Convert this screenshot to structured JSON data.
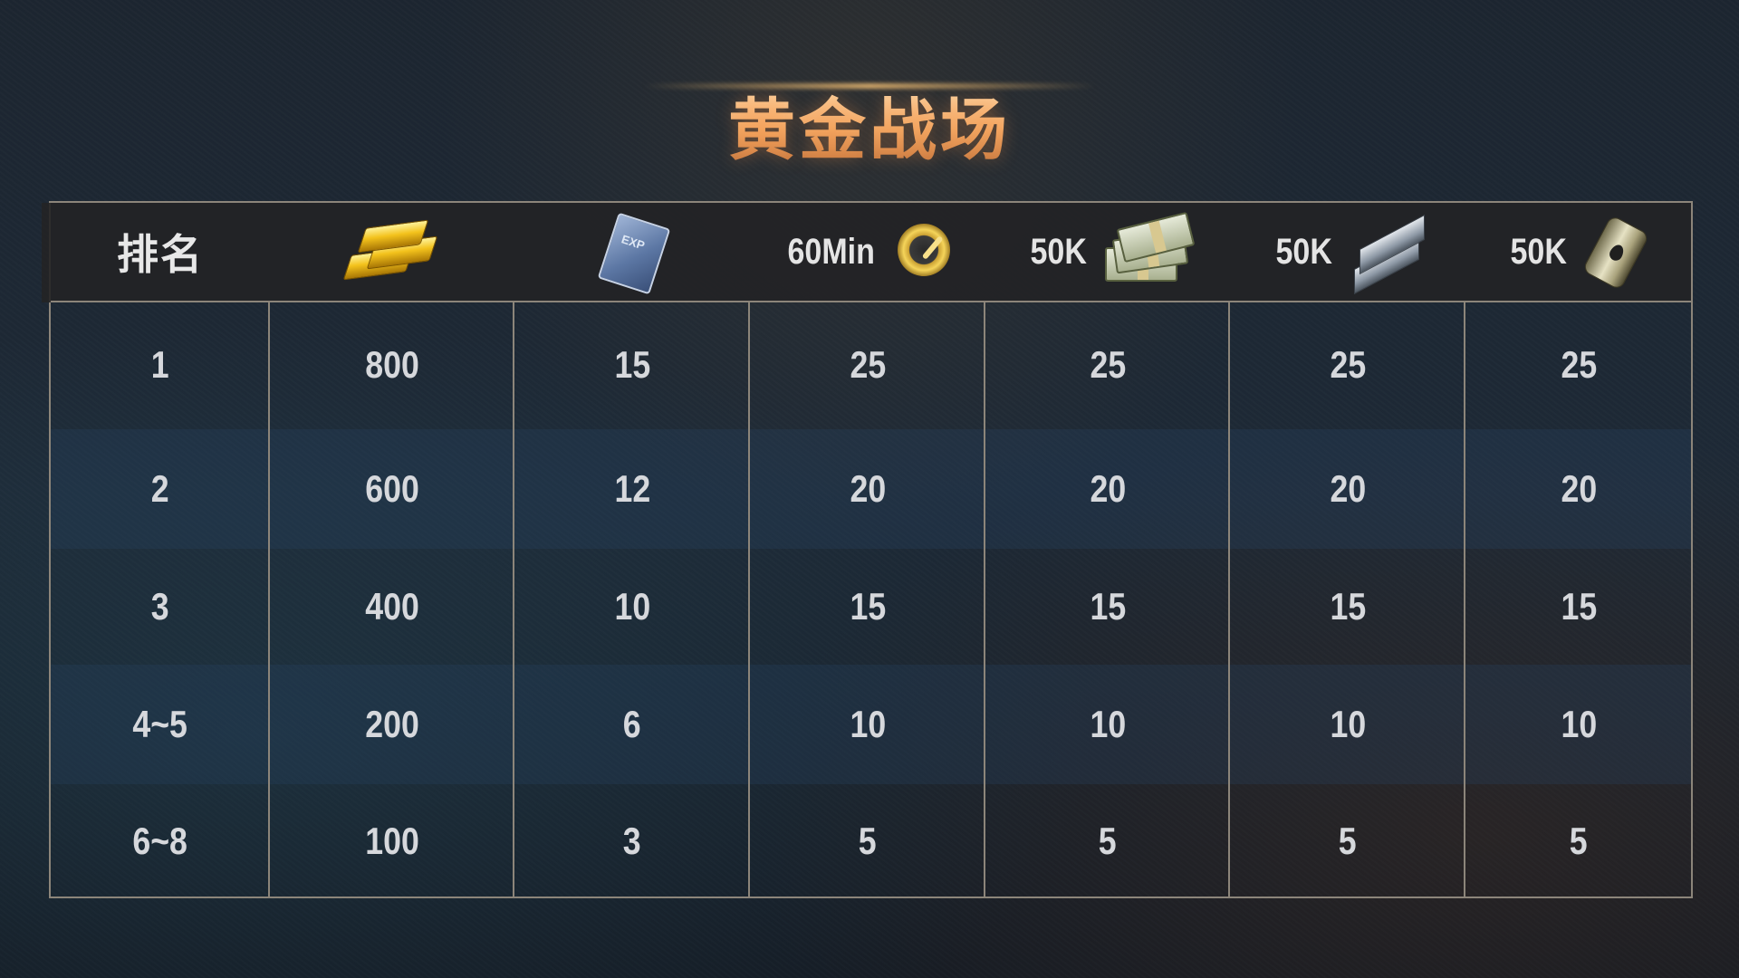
{
  "title": "黄金战场",
  "header": {
    "rank_label": "排名",
    "columns": [
      {
        "key": "gold",
        "label": "",
        "icon": "gold-bars-icon"
      },
      {
        "key": "exp",
        "label": "",
        "icon": "exp-book-icon",
        "icon_text": "EXP"
      },
      {
        "key": "boost",
        "label": "60Min",
        "icon": "boost-gauge-icon"
      },
      {
        "key": "cash",
        "label": "50K",
        "icon": "cash-stack-icon"
      },
      {
        "key": "steel",
        "label": "50K",
        "icon": "steel-beam-icon"
      },
      {
        "key": "oil",
        "label": "50K",
        "icon": "oil-barrel-icon"
      }
    ]
  },
  "rows": [
    {
      "rank": "1",
      "values": [
        "800",
        "15",
        "25",
        "25",
        "25",
        "25"
      ]
    },
    {
      "rank": "2",
      "values": [
        "600",
        "12",
        "20",
        "20",
        "20",
        "20"
      ]
    },
    {
      "rank": "3",
      "values": [
        "400",
        "10",
        "15",
        "15",
        "15",
        "15"
      ]
    },
    {
      "rank": "4~5",
      "values": [
        "200",
        "6",
        "10",
        "10",
        "10",
        "10"
      ]
    },
    {
      "rank": "6~8",
      "values": [
        "100",
        "3",
        "5",
        "5",
        "5",
        "5"
      ]
    }
  ],
  "colors": {
    "title_gradient_top": "#ffe2b8",
    "title_gradient_bottom": "#b86a36",
    "border": "#8c857a",
    "text": "#d6d8dc"
  }
}
